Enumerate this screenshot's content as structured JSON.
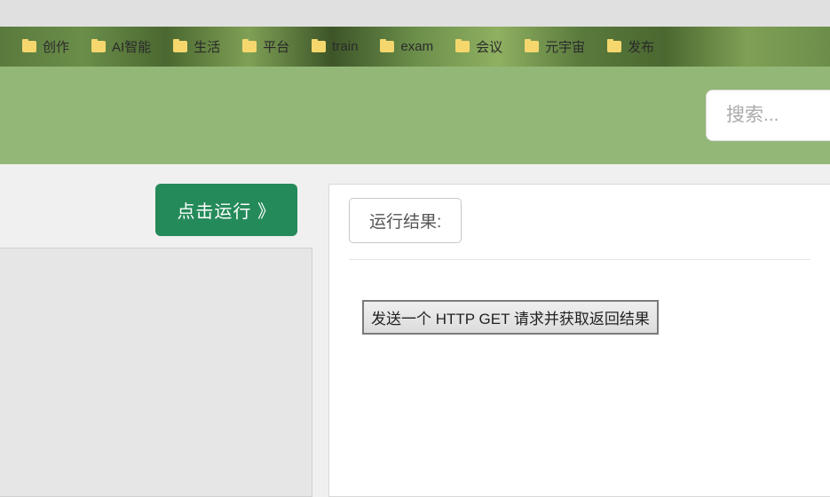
{
  "bookmarks": [
    {
      "label": "创作"
    },
    {
      "label": "AI智能"
    },
    {
      "label": "生活"
    },
    {
      "label": "平台"
    },
    {
      "label": "train"
    },
    {
      "label": "exam"
    },
    {
      "label": "会议"
    },
    {
      "label": "元宇宙"
    },
    {
      "label": "发布"
    }
  ],
  "search": {
    "placeholder": "搜索..."
  },
  "run_button": {
    "label": "点击运行 》"
  },
  "result": {
    "header_label": "运行结果:",
    "action_button_label": "发送一个 HTTP GET 请求并获取返回结果"
  }
}
